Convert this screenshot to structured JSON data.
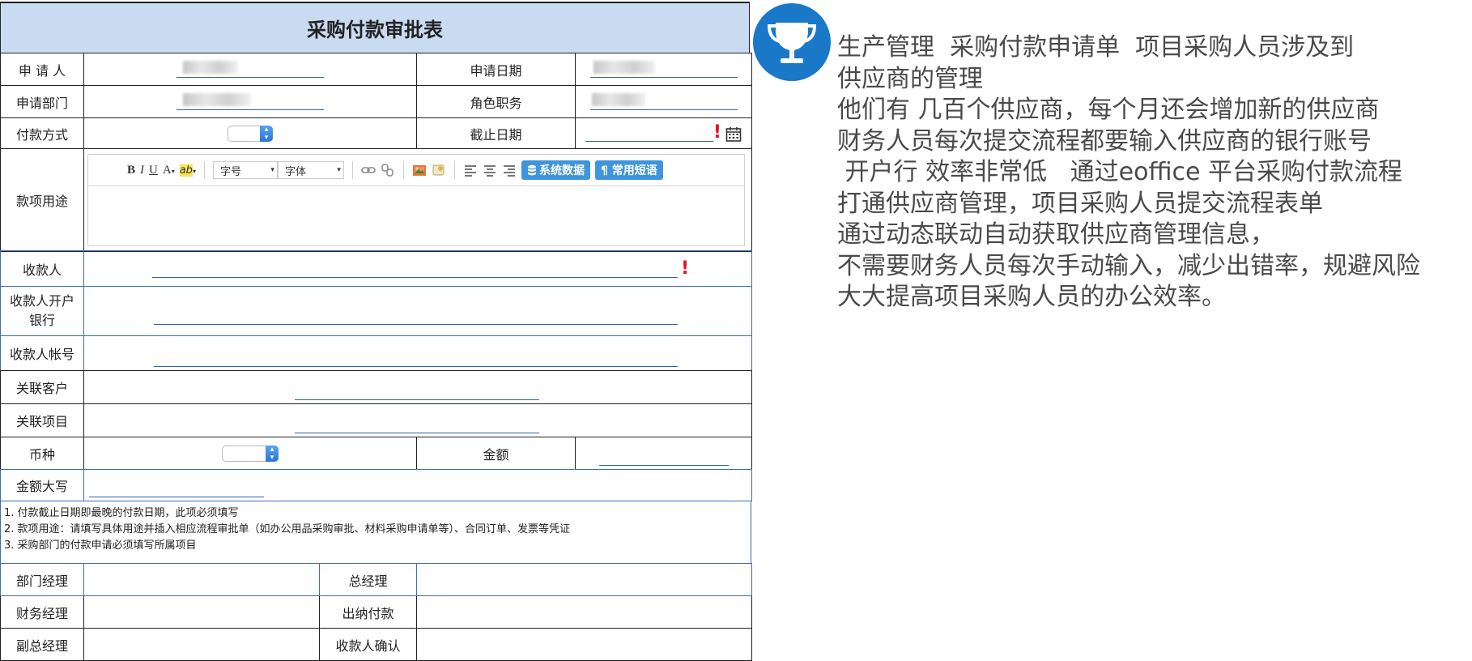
{
  "form": {
    "title": "采购付款审批表",
    "labels": {
      "applicant": "申 请 人",
      "apply_date": "申请日期",
      "department": "申请部门",
      "role": "角色职务",
      "payment_method": "付款方式",
      "deadline": "截止日期",
      "purpose": "款项用途",
      "payee": "收款人",
      "payee_bank": "收款人开户\n银行",
      "payee_account": "收款人帐号",
      "related_customer": "关联客户",
      "related_project": "关联项目",
      "currency": "币种",
      "amount": "金额",
      "amount_upper": "金额大写",
      "dept_manager": "部门经理",
      "general_manager": "总经理",
      "finance_manager": "财务经理",
      "cashier_payment": "出纳付款",
      "deputy_gm": "副总经理",
      "payee_confirm": "收款人确认"
    },
    "editor": {
      "bold": "B",
      "italic": "I",
      "underline": "U",
      "font_color": "A",
      "highlight": "ab",
      "font_size": "字号",
      "font_family": "字体",
      "system_data": "系统数据",
      "common_phrases": "¶ 常用短语"
    },
    "notes": [
      "1. 付款截止日期即最晚的付款日期，此项必须填写",
      "2. 款项用途：请填写具体用途并插入相应流程审批单（如办公用品采购审批、材料采购申请单等）、合同订单、发票等凭证",
      "3. 采购部门的付款申请必须填写所属项目"
    ],
    "required_mark": "!"
  },
  "panel": {
    "icon": "trophy-icon",
    "accent_color": "#1a78c8",
    "lines": [
      "生产管理  采购付款申请单  项目采购人员涉及到",
      "供应商的管理",
      "他们有 几百个供应商，每个月还会增加新的供应商",
      "财务人员每次提交流程都要输入供应商的银行账号",
      " 开户行 效率非常低   通过eoffice 平台采购付款流程",
      "打通供应商管理，项目采购人员提交流程表单",
      "通过动态联动自动获取供应商管理信息，",
      "不需要财务人员每次手动输入，减少出错率，规避风险",
      "大大提高项目采购人员的办公效率。"
    ]
  }
}
